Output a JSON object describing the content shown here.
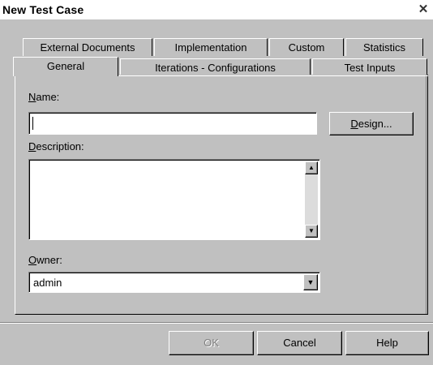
{
  "window": {
    "title": "New Test Case",
    "close": "✕"
  },
  "tabs_row1": [
    {
      "label": "External Documents"
    },
    {
      "label": "Implementation"
    },
    {
      "label": "Custom"
    },
    {
      "label": "Statistics"
    }
  ],
  "tabs_row2": [
    {
      "label": "General",
      "active": true
    },
    {
      "label": "Iterations - Configurations"
    },
    {
      "label": "Test Inputs"
    }
  ],
  "form": {
    "name_label_mnemonic": "N",
    "name_label_rest": "ame:",
    "name_value": "",
    "design_button_mnemonic": "D",
    "design_button_rest": "esign...",
    "description_label_mnemonic": "D",
    "description_label_rest": "escription:",
    "description_value": "",
    "owner_label_mnemonic": "O",
    "owner_label_rest": "wner:",
    "owner_value": "admin"
  },
  "footer": {
    "ok_label": "OK",
    "cancel_label": "Cancel",
    "help_label": "Help"
  }
}
